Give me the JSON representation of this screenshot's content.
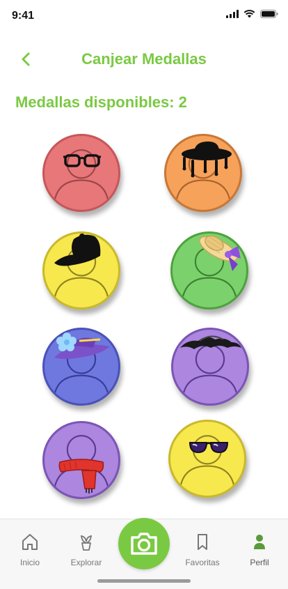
{
  "status_bar": {
    "time": "9:41"
  },
  "header": {
    "title": "Canjear Medallas"
  },
  "available": {
    "label": "Medallas disponibles:",
    "count": "2"
  },
  "medals": [
    {
      "name": "glasses",
      "accent": "#e87779"
    },
    {
      "name": "black-hat-with-hair",
      "accent": "#f6a25a"
    },
    {
      "name": "cap",
      "accent": "#f7e84e"
    },
    {
      "name": "straw-hat-with-bow",
      "accent": "#7bd26c"
    },
    {
      "name": "blue-flower-hat",
      "accent": "#6f78de"
    },
    {
      "name": "witch-hat",
      "accent": "#ac86df"
    },
    {
      "name": "red-scarf",
      "accent": "#ac86df"
    },
    {
      "name": "sunglasses",
      "accent": "#f7e84e"
    }
  ],
  "nav": {
    "inicio": "Inicio",
    "explorar": "Explorar",
    "favoritas": "Favoritas",
    "perfil": "Perfil"
  },
  "colors": {
    "brand_green": "#7ac943"
  }
}
